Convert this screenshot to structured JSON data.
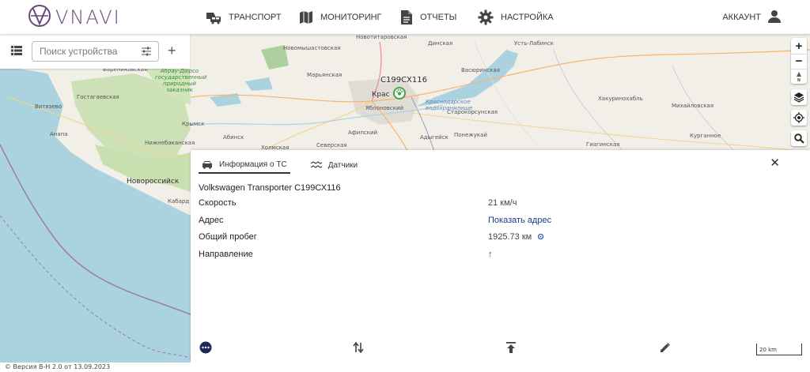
{
  "app": {
    "logo_text": "VNAVI"
  },
  "nav": {
    "items": [
      {
        "label": "Транспорт",
        "icon": "cars-icon"
      },
      {
        "label": "Мониторинг",
        "icon": "map-icon"
      },
      {
        "label": "Отчеты",
        "icon": "document-icon"
      },
      {
        "label": "Настройка",
        "icon": "gear-icon"
      }
    ],
    "account_label": "Аккаунт"
  },
  "search": {
    "placeholder": "Поиск устройства",
    "value": ""
  },
  "map": {
    "labels": {
      "novotitarovskaya": "Новотитаровская",
      "dinskaya": "Динская",
      "novomyshastovskaya": "Новомышастовская",
      "ust_labinsk": "Усть-Лабинск",
      "maryanskaya": "Марьянская",
      "vasyurinskaya": "Васюринская",
      "varenikovskaya": "Варениковская",
      "reserve": "Абрау-Дюрсо государственный природный заказник",
      "gostagaevskaya": "Гостагаевская",
      "vityazevo": "Витязево",
      "krasnodar": "Крас",
      "reservoir": "Краснодарское водохранилище",
      "starokorsunskaya": "Старокорсунская",
      "yablonovsky": "Яблоновский",
      "khakurinokhabl": "Хакуринохабль",
      "mikhaylovskaya": "Михайловская",
      "krymsk": "Крымск",
      "nizhnebakanskaya": "Нижнебаканская",
      "afipsky": "Афипский",
      "adygeysk": "Адыгейск",
      "ponezhukay": "Понежукай",
      "giaginskaya": "Гиагинская",
      "kurgannoe": "Курганное",
      "anapa": "Анапа",
      "abinsk": "Абинск",
      "severskaya": "Северская",
      "kholmskaya": "Холмская",
      "novorossiysk": "Новороссийск",
      "kabardinka": "Кабард"
    }
  },
  "vehicle_marker": {
    "label": "С199СХ116",
    "icon": "paw-icon",
    "status_color": "#46a24a"
  },
  "info_panel": {
    "tabs": [
      {
        "label": "Информация о ТС",
        "icon": "car-icon",
        "active": true
      },
      {
        "label": "Датчики",
        "icon": "sensors-icon",
        "active": false
      }
    ],
    "vehicle_title": "Volkswagen Transporter С199СХ116",
    "rows": [
      {
        "label": "Скорость",
        "value": "21 км/ч"
      },
      {
        "label": "Адрес",
        "value": "Показать адрес"
      },
      {
        "label": "Общий пробег",
        "value": "1925.73 км"
      },
      {
        "label": "Направление",
        "value": "↑"
      }
    ],
    "scale_label": "20 km"
  },
  "footer": {
    "text": "© Версия В-Н 2.0 от 13.09.2023"
  },
  "colors": {
    "brand": "#6a4a7a",
    "accent_dark": "#1a2a5a",
    "link": "#1a3a8a",
    "sea": "#aad3df",
    "land": "#f2efe9",
    "forest": "#c8dfb0"
  }
}
